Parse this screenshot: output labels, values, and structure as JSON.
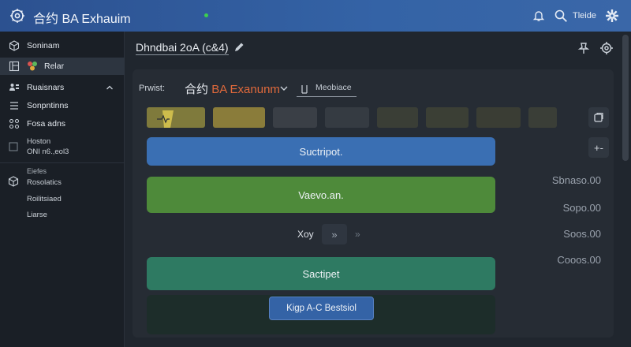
{
  "topbar": {
    "title": "合约 BA Exhauim",
    "user_label": "Tleide",
    "icons": [
      "app-gear-icon",
      "bell-icon",
      "search-icon",
      "settings-icon"
    ],
    "brand_color": "#3463a6"
  },
  "sidebar": {
    "items": [
      {
        "label": "Soninam",
        "icon": "cube-icon"
      },
      {
        "label": "Relar",
        "icon": "palette-icon",
        "active": true
      },
      {
        "label": "Ruaisnars",
        "icon": "users-icon"
      },
      {
        "label": "Sonpntinns",
        "icon": "list-icon"
      },
      {
        "label": "Fosa adns",
        "icon": "grid-icon"
      }
    ],
    "hoston": {
      "label": "Hoston",
      "sub": "ONI n6.,eol3"
    },
    "section": {
      "label": "Eiefes",
      "items": [
        "Rosolatics",
        "Roilitsiaed",
        "Liarse"
      ]
    }
  },
  "main": {
    "doc_title": "Dhndbai 2oA (c&4)",
    "prompt_label": "Prwist:",
    "model_prefix": "合约",
    "model_name": "BA Exanunm",
    "tag_label": "Meobiace",
    "swatches": [
      {
        "color": "#c9b74a",
        "icon": "waveform-icon"
      },
      {
        "color": "#8a7c3a"
      },
      {
        "color": "#3a3f46"
      },
      {
        "color": "#353b42"
      },
      {
        "color": "#3a3e36"
      },
      {
        "color": "#3b3f35"
      },
      {
        "color": "#3a3d34"
      },
      {
        "color": "#3a3e37"
      }
    ],
    "buttons": {
      "primary": "Suctripot.",
      "secondary": "Vaevo.an.",
      "tertiary": "Sactipet",
      "action": "Kigp A-C Bestsiol"
    },
    "pager": {
      "label": "Xoy",
      "next": "»",
      "last": "»"
    },
    "side_metrics": [
      "Sbnaso.00",
      "Sopo.00",
      "Soos.00",
      "Cooos.00"
    ],
    "rail_buttons": [
      "copy-icon",
      "+-"
    ]
  }
}
